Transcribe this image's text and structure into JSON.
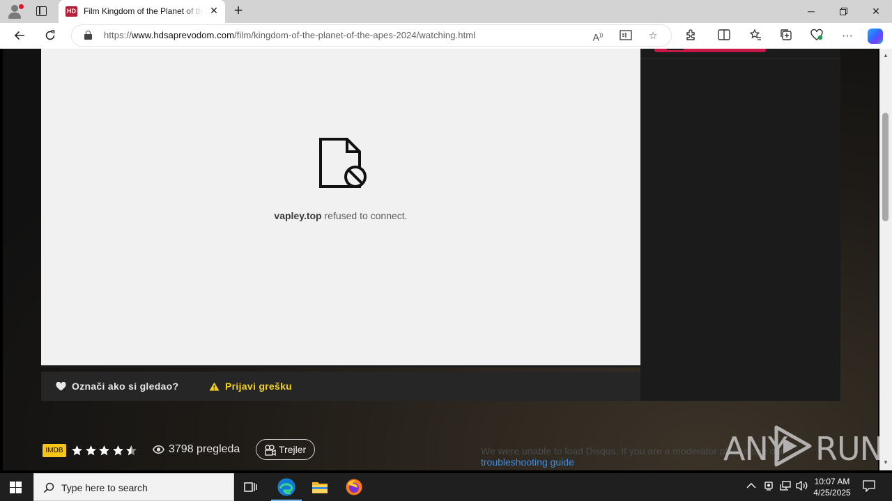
{
  "browser": {
    "tab_title": "Film Kingdom of the Planet of the Apes",
    "tab_favicon_text": "HD",
    "url_prefix": "https://",
    "url_host": "www.hdsaprevodom.com",
    "url_path": "/film/kingdom-of-the-planet-of-the-apes-2024/watching.html"
  },
  "player": {
    "error_host": "vapley.top",
    "error_message": " refused to connect."
  },
  "actions": {
    "watched_label": "Označi ako si gledao?",
    "report_label": "Prijavi grešku",
    "report_color": "#f5d31d"
  },
  "meta": {
    "imdb_badge": "IMDB",
    "rating_stars": 4.5,
    "rating_max": 5,
    "views": "3798 pregleda",
    "trailer_label": "Trejler"
  },
  "disqus": {
    "line1": "We were unable to load Disqus. If you are a moderator please see our",
    "link": "troubleshooting guide"
  },
  "watermark": {
    "left": "ANY",
    "right": "RUN"
  },
  "taskbar": {
    "search_placeholder": "Type here to search",
    "time": "10:07 AM",
    "date": "4/25/2025"
  },
  "colors": {
    "accent": "#c9184a",
    "imdb": "#f5c518",
    "star": "#ffffff"
  }
}
